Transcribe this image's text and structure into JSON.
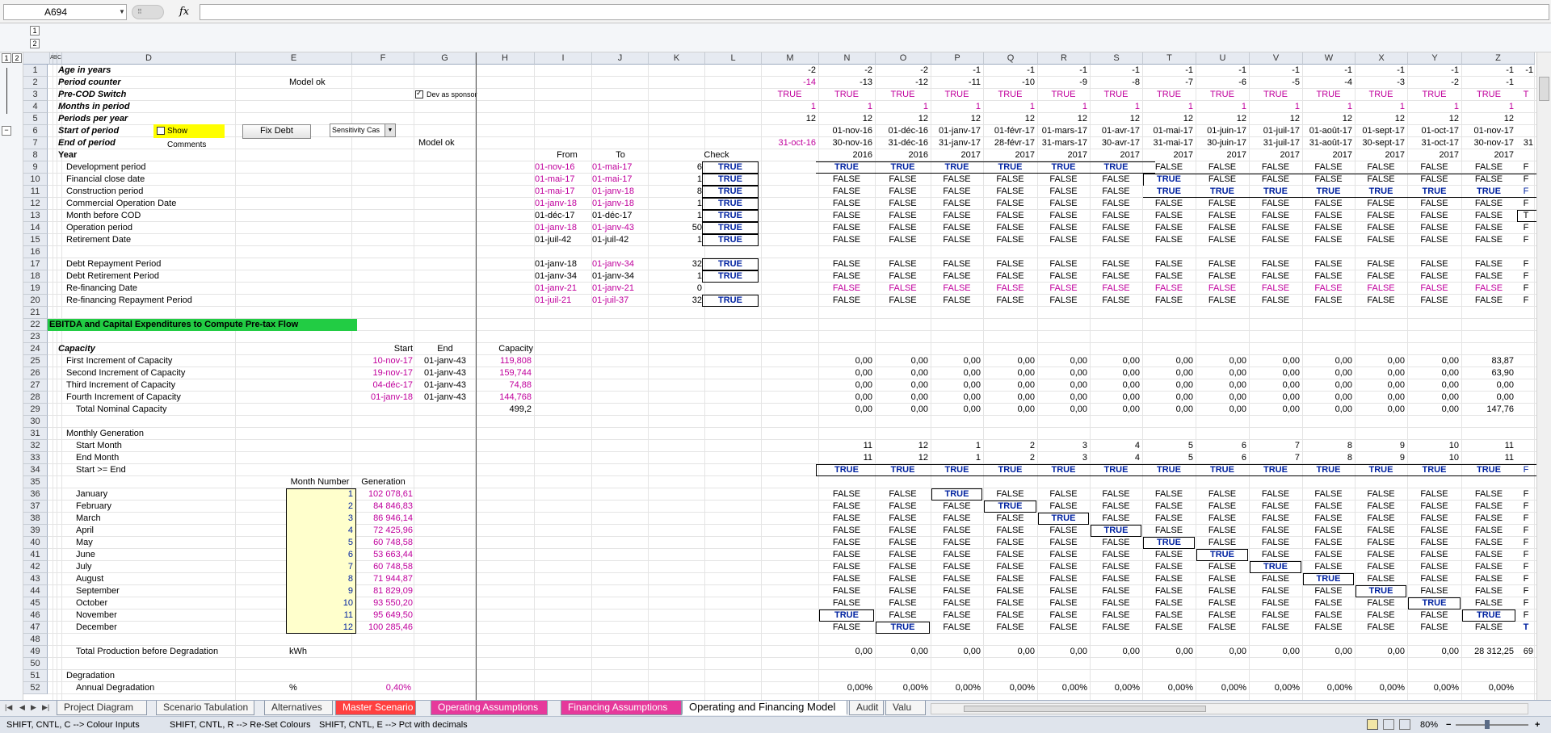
{
  "formula_bar": {
    "name_box": "A694",
    "fx": "fx",
    "formula": ""
  },
  "outline": {
    "levels": [
      "1",
      "2"
    ],
    "row_levels": [
      "1",
      "2"
    ]
  },
  "columns": [
    "A",
    "B",
    "C",
    "D",
    "E",
    "F",
    "G",
    "H",
    "I",
    "J",
    "K",
    "L",
    "M",
    "N",
    "O",
    "P",
    "Q",
    "R",
    "S",
    "T",
    "U",
    "V",
    "W",
    "X",
    "Y",
    "Z"
  ],
  "row_numbers": [
    "1",
    "2",
    "3",
    "4",
    "5",
    "6",
    "7",
    "8",
    "9",
    "10",
    "11",
    "12",
    "13",
    "14",
    "15",
    "16",
    "17",
    "18",
    "19",
    "20",
    "21",
    "22",
    "23",
    "24",
    "25",
    "26",
    "27",
    "28",
    "29",
    "30",
    "31",
    "32",
    "33",
    "34",
    "35",
    "36",
    "37",
    "38",
    "39",
    "40",
    "41",
    "42",
    "43",
    "44",
    "45",
    "46",
    "47",
    "48",
    "49",
    "50",
    "51",
    "52"
  ],
  "labels": {
    "r1": "Age in years",
    "r2": "Period counter",
    "r2e": "Model ok",
    "r3": "Pre-COD Switch",
    "r4": "Months in period",
    "r5": "Periods per year",
    "r6": "Start of period",
    "r7": "End of period",
    "r7g": "Model ok",
    "r8": "Year",
    "r8i": "From",
    "r8j": "To",
    "r8l": "Check",
    "r9": "Development period",
    "r10": "Financial close date",
    "r11": "Construction period",
    "r12": "Commercial Operation Date",
    "r13": "Month before COD",
    "r14": "Operation period",
    "r15": "Retirement Date",
    "r17": "Debt Repayment Period",
    "r18": "Debt Retirement Period",
    "r19": "Re-financing Date",
    "r20": "Re-financing Repayment Period",
    "r22": "EBITDA and Capital Expenditures to Compute Pre-tax Flow",
    "r24": "Capacity",
    "r24f": "Start",
    "r24g": "End",
    "r24h": "Capacity",
    "r25": "First Increment of Capacity",
    "r26": "Second Increment of Capacity",
    "r27": "Third Increment of Capacity",
    "r28": "Fourth Increment of Capacity",
    "r29": "Total Nominal Capacity",
    "r31": "Monthly Generation",
    "r32": "Start Month",
    "r33": "End Month",
    "r34": "Start >= End",
    "r35e": "Month Number",
    "r35f": "Generation",
    "r49": "Total Production before Degradation",
    "r49e": "kWh",
    "r51": "Degradation",
    "r52": "Annual Degradation",
    "r52e": "%",
    "r52f": "0,40%"
  },
  "controls": {
    "dev_as_sponsor": "Dev as sponsor",
    "show_comments": "Show Comments",
    "fix_debt": "Fix Debt",
    "sensitivity": "Sensitivity Cas"
  },
  "timing": [
    {
      "r": "9",
      "i": "01-nov-16",
      "j": "01-mai-17",
      "k": "6",
      "l": "TRUE"
    },
    {
      "r": "10",
      "i": "01-mai-17",
      "j": "01-mai-17",
      "k": "1",
      "l": "TRUE"
    },
    {
      "r": "11",
      "i": "01-mai-17",
      "j": "01-janv-18",
      "k": "8",
      "l": "TRUE"
    },
    {
      "r": "12",
      "i": "01-janv-18",
      "j": "01-janv-18",
      "k": "1",
      "l": "TRUE"
    },
    {
      "r": "13",
      "i": "01-déc-17",
      "j": "01-déc-17",
      "k": "1",
      "l": "TRUE"
    },
    {
      "r": "14",
      "i": "01-janv-18",
      "j": "01-janv-43",
      "k": "50",
      "l": "TRUE"
    },
    {
      "r": "15",
      "i": "01-juil-42",
      "j": "01-juil-42",
      "k": "1",
      "l": "TRUE"
    },
    {
      "r": "17",
      "i": "01-janv-18",
      "j": "01-janv-34",
      "k": "32",
      "l": "TRUE"
    },
    {
      "r": "18",
      "i": "01-janv-34",
      "j": "01-janv-34",
      "k": "1",
      "l": "TRUE"
    },
    {
      "r": "19",
      "i": "01-janv-21",
      "j": "01-janv-21",
      "k": "0",
      "l": ""
    },
    {
      "r": "20",
      "i": "01-juil-21",
      "j": "01-juil-37",
      "k": "32",
      "l": "TRUE"
    }
  ],
  "capacity": [
    {
      "f": "10-nov-17",
      "g": "01-janv-43",
      "h": "119,808"
    },
    {
      "f": "19-nov-17",
      "g": "01-janv-43",
      "h": "159,744"
    },
    {
      "f": "04-déc-17",
      "g": "01-janv-43",
      "h": "74,88"
    },
    {
      "f": "01-janv-18",
      "g": "01-janv-43",
      "h": "144,768"
    }
  ],
  "capacity_total": "499,2",
  "months": [
    {
      "name": "January",
      "num": "1",
      "gen": "102 078,61"
    },
    {
      "name": "February",
      "num": "2",
      "gen": "84 846,83"
    },
    {
      "name": "March",
      "num": "3",
      "gen": "86 946,14"
    },
    {
      "name": "April",
      "num": "4",
      "gen": "72 425,96"
    },
    {
      "name": "May",
      "num": "5",
      "gen": "60 748,58"
    },
    {
      "name": "June",
      "num": "6",
      "gen": "53 663,44"
    },
    {
      "name": "July",
      "num": "7",
      "gen": "60 748,58"
    },
    {
      "name": "August",
      "num": "8",
      "gen": "71 944,87"
    },
    {
      "name": "September",
      "num": "9",
      "gen": "81 829,09"
    },
    {
      "name": "October",
      "num": "10",
      "gen": "93 550,20"
    },
    {
      "name": "November",
      "num": "11",
      "gen": "95 649,50"
    },
    {
      "name": "December",
      "num": "12",
      "gen": "100 285,46"
    }
  ],
  "timeline": {
    "age": [
      "-2",
      "-2",
      "-2",
      "-1",
      "-1",
      "-1",
      "-1",
      "-1",
      "-1",
      "-1",
      "-1",
      "-1",
      "-1",
      "-1",
      "-1"
    ],
    "counter": [
      "-14",
      "-13",
      "-12",
      "-11",
      "-10",
      "-9",
      "-8",
      "-7",
      "-6",
      "-5",
      "-4",
      "-3",
      "-2",
      "-1"
    ],
    "precod": [
      "TRUE",
      "TRUE",
      "TRUE",
      "TRUE",
      "TRUE",
      "TRUE",
      "TRUE",
      "TRUE",
      "TRUE",
      "TRUE",
      "TRUE",
      "TRUE",
      "TRUE",
      "TRUE",
      "T"
    ],
    "months": [
      "1",
      "1",
      "1",
      "1",
      "1",
      "1",
      "1",
      "1",
      "1",
      "1",
      "1",
      "1",
      "1",
      "1"
    ],
    "ppy": [
      "12",
      "12",
      "12",
      "12",
      "12",
      "12",
      "12",
      "12",
      "12",
      "12",
      "12",
      "12",
      "12",
      "12"
    ],
    "start": [
      "",
      "01-nov-16",
      "01-déc-16",
      "01-janv-17",
      "01-févr-17",
      "01-mars-17",
      "01-avr-17",
      "01-mai-17",
      "01-juin-17",
      "01-juil-17",
      "01-août-17",
      "01-sept-17",
      "01-oct-17",
      "01-nov-17"
    ],
    "end": [
      "31-oct-16",
      "30-nov-16",
      "31-déc-16",
      "31-janv-17",
      "28-févr-17",
      "31-mars-17",
      "30-avr-17",
      "31-mai-17",
      "30-juin-17",
      "31-juil-17",
      "31-août-17",
      "30-sept-17",
      "31-oct-17",
      "30-nov-17",
      "31"
    ],
    "year": [
      "",
      "2016",
      "2016",
      "2017",
      "2017",
      "2017",
      "2017",
      "2017",
      "2017",
      "2017",
      "2017",
      "2017",
      "2017",
      "2017"
    ],
    "cap25": [
      "0,00",
      "0,00",
      "0,00",
      "0,00",
      "0,00",
      "0,00",
      "0,00",
      "0,00",
      "0,00",
      "0,00",
      "0,00",
      "0,00",
      "83,87"
    ],
    "cap26": [
      "0,00",
      "0,00",
      "0,00",
      "0,00",
      "0,00",
      "0,00",
      "0,00",
      "0,00",
      "0,00",
      "0,00",
      "0,00",
      "0,00",
      "63,90"
    ],
    "cap27": [
      "0,00",
      "0,00",
      "0,00",
      "0,00",
      "0,00",
      "0,00",
      "0,00",
      "0,00",
      "0,00",
      "0,00",
      "0,00",
      "0,00",
      "0,00"
    ],
    "cap28": [
      "0,00",
      "0,00",
      "0,00",
      "0,00",
      "0,00",
      "0,00",
      "0,00",
      "0,00",
      "0,00",
      "0,00",
      "0,00",
      "0,00",
      "0,00"
    ],
    "cap29": [
      "0,00",
      "0,00",
      "0,00",
      "0,00",
      "0,00",
      "0,00",
      "0,00",
      "0,00",
      "0,00",
      "0,00",
      "0,00",
      "0,00",
      "147,76"
    ],
    "startm": [
      "11",
      "12",
      "1",
      "2",
      "3",
      "4",
      "5",
      "6",
      "7",
      "8",
      "9",
      "10",
      "11"
    ],
    "endm": [
      "11",
      "12",
      "1",
      "2",
      "3",
      "4",
      "5",
      "6",
      "7",
      "8",
      "9",
      "10",
      "11"
    ],
    "prod": [
      "0,00",
      "0,00",
      "0,00",
      "0,00",
      "0,00",
      "0,00",
      "0,00",
      "0,00",
      "0,00",
      "0,00",
      "0,00",
      "0,00",
      "28 312,25",
      "69"
    ],
    "degr": [
      "0,00%",
      "0,00%",
      "0,00%",
      "0,00%",
      "0,00%",
      "0,00%",
      "0,00%",
      "0,00%",
      "0,00%",
      "0,00%",
      "0,00%",
      "0,00%",
      "0,00%"
    ]
  },
  "tabs": [
    "Project Diagram",
    "Scenario Tabulation",
    "Alternatives",
    "Master Scenario",
    "Operating Assumptions",
    "Financing Assumptions",
    "Operating and Financing Model",
    "Audit",
    "Valu"
  ],
  "status": {
    "s1": "SHIFT, CNTL, C --> Colour Inputs",
    "s2": "SHIFT, CNTL, R --> Re-Set Colours",
    "s3": "SHIFT, CNTL, E --> Pct with decimals",
    "zoom": "80%"
  },
  "words": {
    "true": "TRUE",
    "false": "FALSE",
    "f": "F",
    "t": "T",
    "dot": "."
  }
}
